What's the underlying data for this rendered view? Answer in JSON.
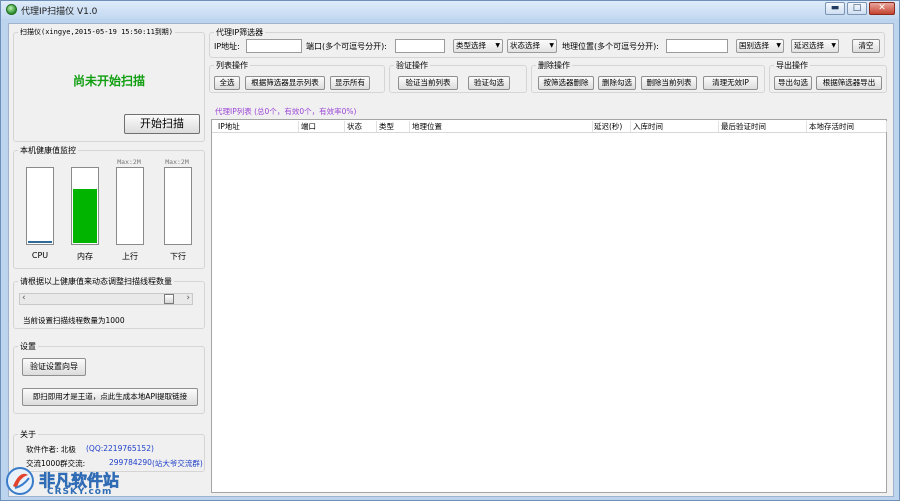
{
  "window": {
    "title": "代理IP扫描仪 V1.0"
  },
  "window_buttons": {
    "minimize": "▬",
    "maximize": "□",
    "close": "✕"
  },
  "scanner": {
    "group_title": "扫描仪(xingye,2015-05-19 15:50:11到期)",
    "status_text": "尚未开始扫描",
    "start_button": "开始扫描"
  },
  "health": {
    "group_title": "本机健康值监控",
    "meters": [
      {
        "name": "CPU",
        "max_label": "",
        "percent_label": "",
        "fill": 0.02
      },
      {
        "name": "内存",
        "max_label": "",
        "percent_label": "71%",
        "fill": 0.71
      },
      {
        "name": "上行",
        "max_label": "Max:2M",
        "percent_label": "",
        "fill": 0
      },
      {
        "name": "下行",
        "max_label": "Max:2M",
        "percent_label": "",
        "fill": 0
      }
    ]
  },
  "threads": {
    "group_title": "请根据以上健康值来动态调整扫描线程数量",
    "current_text": "当前设置扫描线程数量为1000",
    "slider_left_arrow": "‹",
    "slider_right_arrow": "›",
    "slider_level": 0.93
  },
  "settings": {
    "group_title": "设置",
    "verify_wizard_button": "验证设置向导",
    "api_button": "即扫即用才是王道，点此生成本地API提取链接"
  },
  "about": {
    "group_title": "关于",
    "author_label": "软件作者: 北极",
    "author_qq": "(QQ:2219765152)",
    "group_label": "交流1000群交流:",
    "group_number": "299784290",
    "group_name": "(站大爷交流群)"
  },
  "filter": {
    "group_title": "代理IP筛选器",
    "ip_label": "IP地址:",
    "ip_value": "",
    "port_label": "端口(多个可逗号分开):",
    "port_value": "",
    "type_select": "类型选择",
    "status_select": "状态选择",
    "geo_label": "地理位置(多个可逗号分开):",
    "geo_value": "",
    "country_select": "国别选择",
    "latency_select": "延迟选择",
    "clear_button": "清空"
  },
  "list_ops": {
    "group_title": "列表操作",
    "select_all": "全选",
    "show_by_filter": "根据筛选器显示列表",
    "show_all": "显示所有"
  },
  "verify_ops": {
    "group_title": "验证操作",
    "verify_list": "验证当前列表",
    "verify_checked": "验证勾选"
  },
  "delete_ops": {
    "group_title": "删除操作",
    "delete_by_filter": "按筛选器删除",
    "delete_checked": "删除勾选",
    "delete_list": "删除当前列表",
    "clear_invalid": "清理无效IP"
  },
  "export_ops": {
    "group_title": "导出操作",
    "export_checked": "导出勾选",
    "export_by_filter": "根据筛选器导出"
  },
  "table": {
    "summary": "代理IP列表 (总0个，有效0个，有效率0%)",
    "columns": [
      "IP地址",
      "端口",
      "状态",
      "类型",
      "地理位置",
      "延迟(秒)",
      "入库时间",
      "最后验证时间",
      "本地存活时间"
    ],
    "rows": []
  },
  "watermark": {
    "text": "非凡软件站",
    "subtext": "CRSKY.com"
  },
  "colors": {
    "accent_green": "#00b400",
    "status_green": "#119f11",
    "link_blue": "#1f3fc9",
    "summary_purple": "#9a45d6"
  }
}
